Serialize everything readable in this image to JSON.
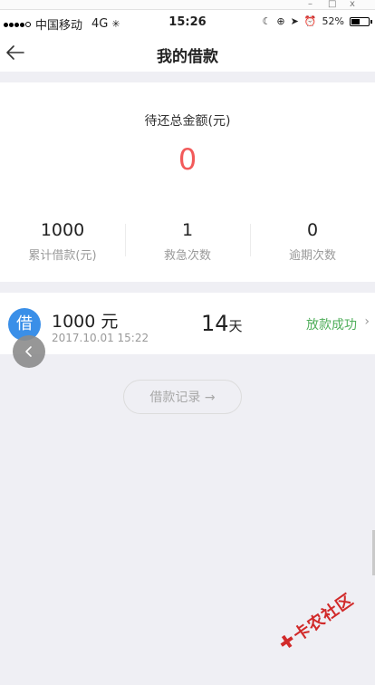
{
  "chrome": {
    "close_label": "x"
  },
  "status_bar": {
    "carrier": "中国移动",
    "network": "4G",
    "time": "15:26",
    "battery_pct": "52%",
    "battery_level": 0.52
  },
  "nav": {
    "title": "我的借款"
  },
  "summary": {
    "label": "待还总金额(元)",
    "amount": "0",
    "amount_color": "#f25a5a",
    "stats": [
      {
        "value": "1000",
        "label": "累计借款(元)"
      },
      {
        "value": "1",
        "label": "救急次数"
      },
      {
        "value": "0",
        "label": "逾期次数"
      }
    ]
  },
  "loan": {
    "badge": "借",
    "amount": "1000 元",
    "date": "2017.10.01  15:22",
    "days_value": "14",
    "days_unit": "天",
    "status": "放款成功",
    "status_color": "#4fae5a"
  },
  "records_button": {
    "label": "借款记录 →"
  },
  "watermark": {
    "text": "卡农社区"
  }
}
